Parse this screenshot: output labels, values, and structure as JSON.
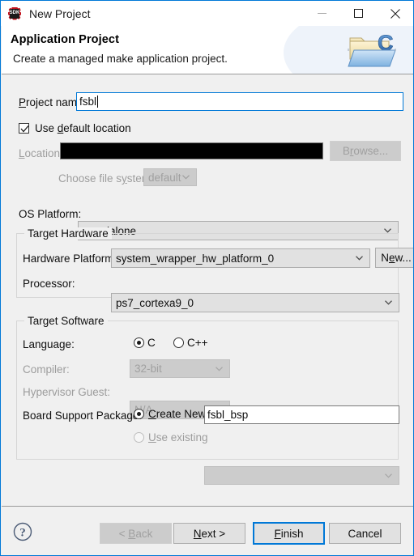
{
  "window": {
    "title": "New Project",
    "icon": "sdk-logo-icon",
    "minimize_label": "—",
    "maximize_label": "□",
    "close_label": "✕"
  },
  "header": {
    "title": "Application Project",
    "subtitle": "Create a managed make application project.",
    "graphic": "folder-c-icon"
  },
  "form": {
    "project_name": {
      "label": "Project name:",
      "mnemonic": "P",
      "value": "fsbl"
    },
    "use_default_location": {
      "label": "Use default location",
      "mnemonic": "d",
      "checked": true
    },
    "location": {
      "label": "Location:",
      "mnemonic": "L",
      "value": "",
      "redacted": true,
      "enabled": false
    },
    "browse_button": {
      "label": "Browse...",
      "mnemonic": "r",
      "enabled": false
    },
    "choose_file_system": {
      "label": "Choose file system:",
      "mnemonic": "y",
      "value": "default",
      "enabled": false
    },
    "os_platform": {
      "label": "OS Platform:",
      "value": "standalone",
      "enabled": true
    }
  },
  "target_hardware": {
    "group_title": "Target Hardware",
    "hardware_platform": {
      "label": "Hardware Platform:",
      "value": "system_wrapper_hw_platform_0"
    },
    "new_button": {
      "label": "New...",
      "mnemonic": "e"
    },
    "processor": {
      "label": "Processor:",
      "value": "ps7_cortexa9_0"
    }
  },
  "target_software": {
    "group_title": "Target Software",
    "language": {
      "label": "Language:",
      "options": [
        {
          "label": "C",
          "selected": true
        },
        {
          "label": "C++",
          "selected": false
        }
      ]
    },
    "compiler": {
      "label": "Compiler:",
      "value": "32-bit",
      "enabled": false
    },
    "hypervisor_guest": {
      "label": "Hypervisor Guest:",
      "value": "N/A",
      "enabled": false
    },
    "board_support_package": {
      "label": "Board Support Package:",
      "create_new": {
        "label": "Create New",
        "mnemonic": "C",
        "selected": true,
        "value": "fsbl_bsp"
      },
      "use_existing": {
        "label": "Use existing",
        "mnemonic": "U",
        "selected": false,
        "value": "",
        "enabled": false
      }
    }
  },
  "footer": {
    "help_icon": "help-question-icon",
    "back_button": {
      "label": "< Back",
      "mnemonic": "B",
      "enabled": false
    },
    "next_button": {
      "label": "Next >",
      "mnemonic": "N",
      "enabled": true
    },
    "finish_button": {
      "label": "Finish",
      "mnemonic": "F",
      "enabled": true,
      "default": true
    },
    "cancel_button": {
      "label": "Cancel",
      "enabled": true
    }
  },
  "colors": {
    "accent": "#0078d7",
    "window_bg": "#f0f0f0",
    "header_bg": "#ffffff",
    "control_bg": "#e1e1e1",
    "disabled_text": "#a0a0a0"
  }
}
